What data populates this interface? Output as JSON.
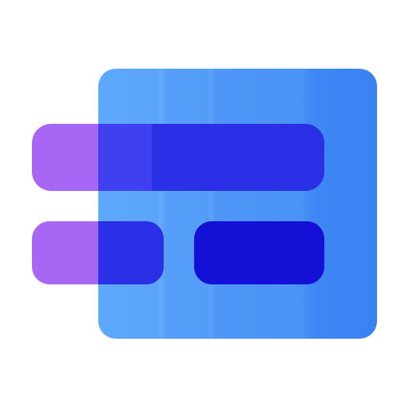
{
  "logo": {
    "icon": "stacked-bars-card-icon",
    "colors": {
      "card_light": "#5ea8fa",
      "card_mid": "#529bf7",
      "card_dark": "#3b83f4",
      "bar_purple": "#a866f5",
      "bar_blue_overlap": "#3f3cf0",
      "bar_blue": "#2a2ee5",
      "bar_deep": "#1410d6"
    }
  }
}
